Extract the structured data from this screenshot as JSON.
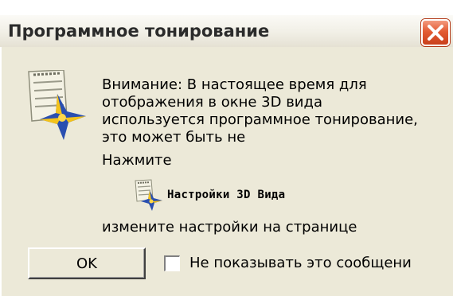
{
  "dialog": {
    "title": "Программное тонирование",
    "message": "Внимание: В настоящее время для отображения в окне 3D вида используется программное тонирование, это может быть не",
    "press_text": "Нажмите",
    "settings_link_label": "Настройки 3D Вида",
    "change_text": "измените настройки на странице",
    "ok_label": "OK",
    "checkbox_label": "Не показывать это сообщени",
    "checkbox_checked": false
  },
  "icons": {
    "window_close": "close-icon",
    "message": "3d-settings-icon",
    "settings_link": "3d-settings-icon"
  },
  "colors": {
    "dialog_background": "#ece9d8",
    "close_button": "#e35b33"
  }
}
